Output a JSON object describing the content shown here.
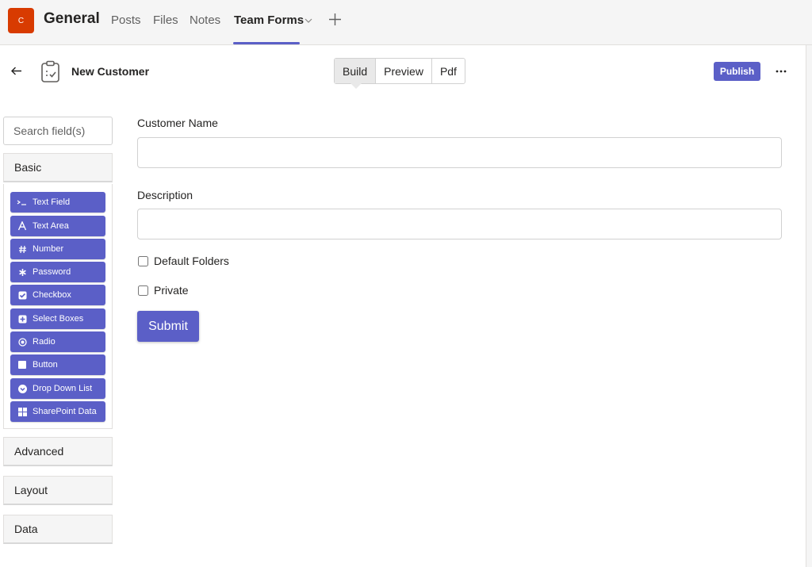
{
  "topbar": {
    "avatar_letter": "C",
    "channel_title": "General",
    "tabs": [
      {
        "label": "Posts"
      },
      {
        "label": "Files"
      },
      {
        "label": "Notes"
      },
      {
        "label": "Team Forms"
      }
    ],
    "accent_color": "#5b5fc7",
    "avatar_color": "#d83b01"
  },
  "form_header": {
    "title": "New Customer",
    "modes": [
      "Build",
      "Preview",
      "Pdf"
    ],
    "active_mode": "Build",
    "publish_label": "Publish",
    "icons": [
      "back-arrow-icon",
      "clipboard-form-icon",
      "more-options-icon"
    ]
  },
  "components": {
    "search_placeholder": "Search field(s)",
    "groups": {
      "basic": "Basic",
      "advanced": "Advanced",
      "layout": "Layout",
      "data": "Data"
    },
    "basic_items": [
      {
        "label": "Text Field",
        "icon": "terminal-icon"
      },
      {
        "label": "Text Area",
        "icon": "font-a-icon"
      },
      {
        "label": "Number",
        "icon": "hash-icon"
      },
      {
        "label": "Password",
        "icon": "asterisk-icon"
      },
      {
        "label": "Checkbox",
        "icon": "checkbox-icon"
      },
      {
        "label": "Select Boxes",
        "icon": "plus-square-icon"
      },
      {
        "label": "Radio",
        "icon": "radio-dot-icon"
      },
      {
        "label": "Button",
        "icon": "square-icon"
      },
      {
        "label": "Drop Down List",
        "icon": "chevron-circle-icon"
      },
      {
        "label": "SharePoint Data",
        "icon": "windows-icon"
      }
    ]
  },
  "form": {
    "customer_name_label": "Customer Name",
    "customer_name_value": "",
    "description_label": "Description",
    "description_value": "",
    "default_folders_label": "Default Folders",
    "default_folders_checked": false,
    "private_label": "Private",
    "private_checked": false,
    "submit_label": "Submit"
  }
}
